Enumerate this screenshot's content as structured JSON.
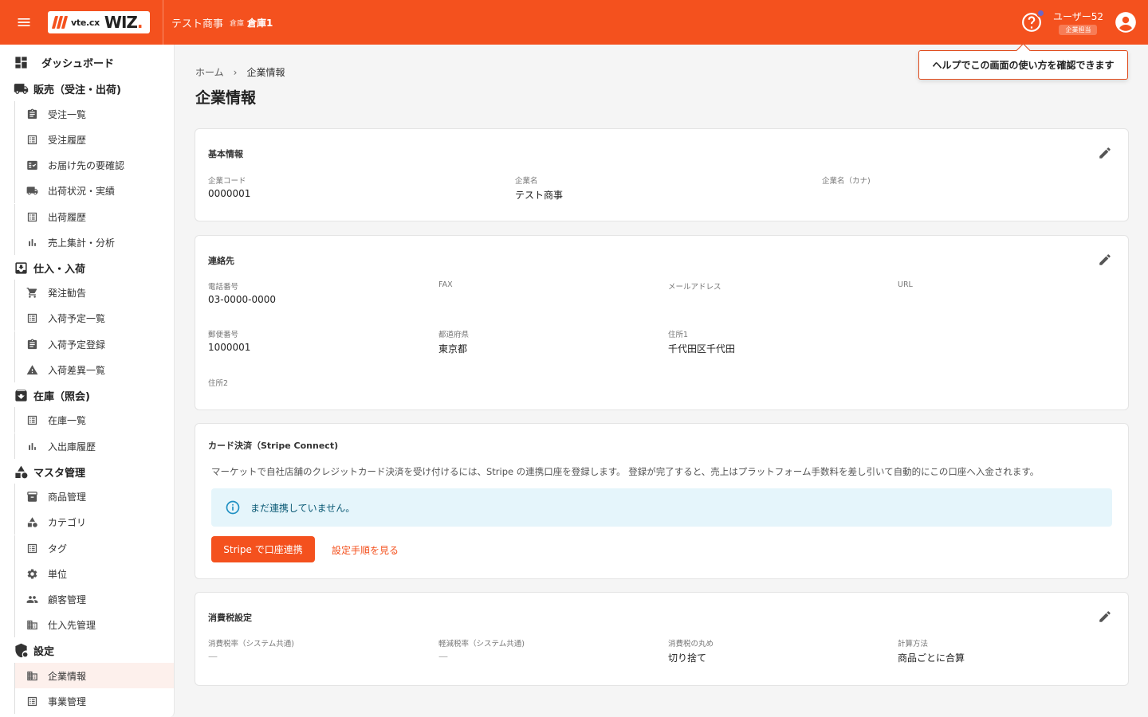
{
  "header": {
    "logo_small": "vte.cx",
    "logo_big": "WIZ",
    "logo_dot": ".",
    "company": "テスト商事",
    "warehouse_label": "倉庫",
    "warehouse_name": "倉庫1",
    "user_name": "ユーザー52",
    "user_role": "企業担当"
  },
  "tooltip": "ヘルプでこの画面の使い方を確認できます",
  "sidebar": {
    "dashboard": "ダッシュボード",
    "sales": {
      "label": "販売（受注・出荷)",
      "items": [
        "受注一覧",
        "受注履歴",
        "お届け先の要確認",
        "出荷状況・実績",
        "出荷履歴",
        "売上集計・分析"
      ]
    },
    "purchase": {
      "label": "仕入・入荷",
      "items": [
        "発注勧告",
        "入荷予定一覧",
        "入荷予定登録",
        "入荷差異一覧"
      ]
    },
    "stock": {
      "label": "在庫（照会)",
      "items": [
        "在庫一覧",
        "入出庫履歴"
      ]
    },
    "master": {
      "label": "マスタ管理",
      "items": [
        "商品管理",
        "カテゴリ",
        "タグ",
        "単位",
        "顧客管理",
        "仕入先管理"
      ]
    },
    "settings": {
      "label": "設定",
      "items": [
        "企業情報",
        "事業管理"
      ]
    }
  },
  "breadcrumb": {
    "home": "ホーム",
    "separator": "›",
    "current": "企業情報"
  },
  "page_title": "企業情報",
  "basic": {
    "title": "基本情報",
    "fields": [
      {
        "label": "企業コード",
        "value": "0000001"
      },
      {
        "label": "企業名",
        "value": "テスト商事"
      },
      {
        "label": "企業名（カナ)",
        "value": ""
      }
    ]
  },
  "contact": {
    "title": "連絡先",
    "fields": [
      {
        "label": "電話番号",
        "value": "03-0000-0000"
      },
      {
        "label": "FAX",
        "value": ""
      },
      {
        "label": "メールアドレス",
        "value": ""
      },
      {
        "label": "URL",
        "value": ""
      },
      {
        "label": "郵便番号",
        "value": "1000001"
      },
      {
        "label": "都道府県",
        "value": "東京都"
      },
      {
        "label": "住所1",
        "value": "千代田区千代田"
      },
      {
        "label": "住所2",
        "value": ""
      }
    ]
  },
  "stripe": {
    "title": "カード決済（Stripe Connect)",
    "description": "マーケットで自社店舗のクレジットカード決済を受け付けるには、Stripe の連携口座を登録します。 登録が完了すると、売上はプラットフォーム手数料を差し引いて自動的にこの口座へ入金されます。",
    "info": "まだ連携していません。",
    "button": "Stripe で口座連携",
    "link": "設定手順を見る"
  },
  "tax": {
    "title": "消費税設定",
    "fields": [
      {
        "label": "消費税率（システム共通)",
        "value": "—"
      },
      {
        "label": "軽減税率（システム共通)",
        "value": "—"
      },
      {
        "label": "消費税の丸め",
        "value": "切り捨て"
      },
      {
        "label": "計算方法",
        "value": "商品ごとに合算"
      }
    ]
  },
  "colors": {
    "brand": "#f4511e",
    "info_bg": "#e5f5fb",
    "active_nav_bg": "#fdf0ec"
  }
}
